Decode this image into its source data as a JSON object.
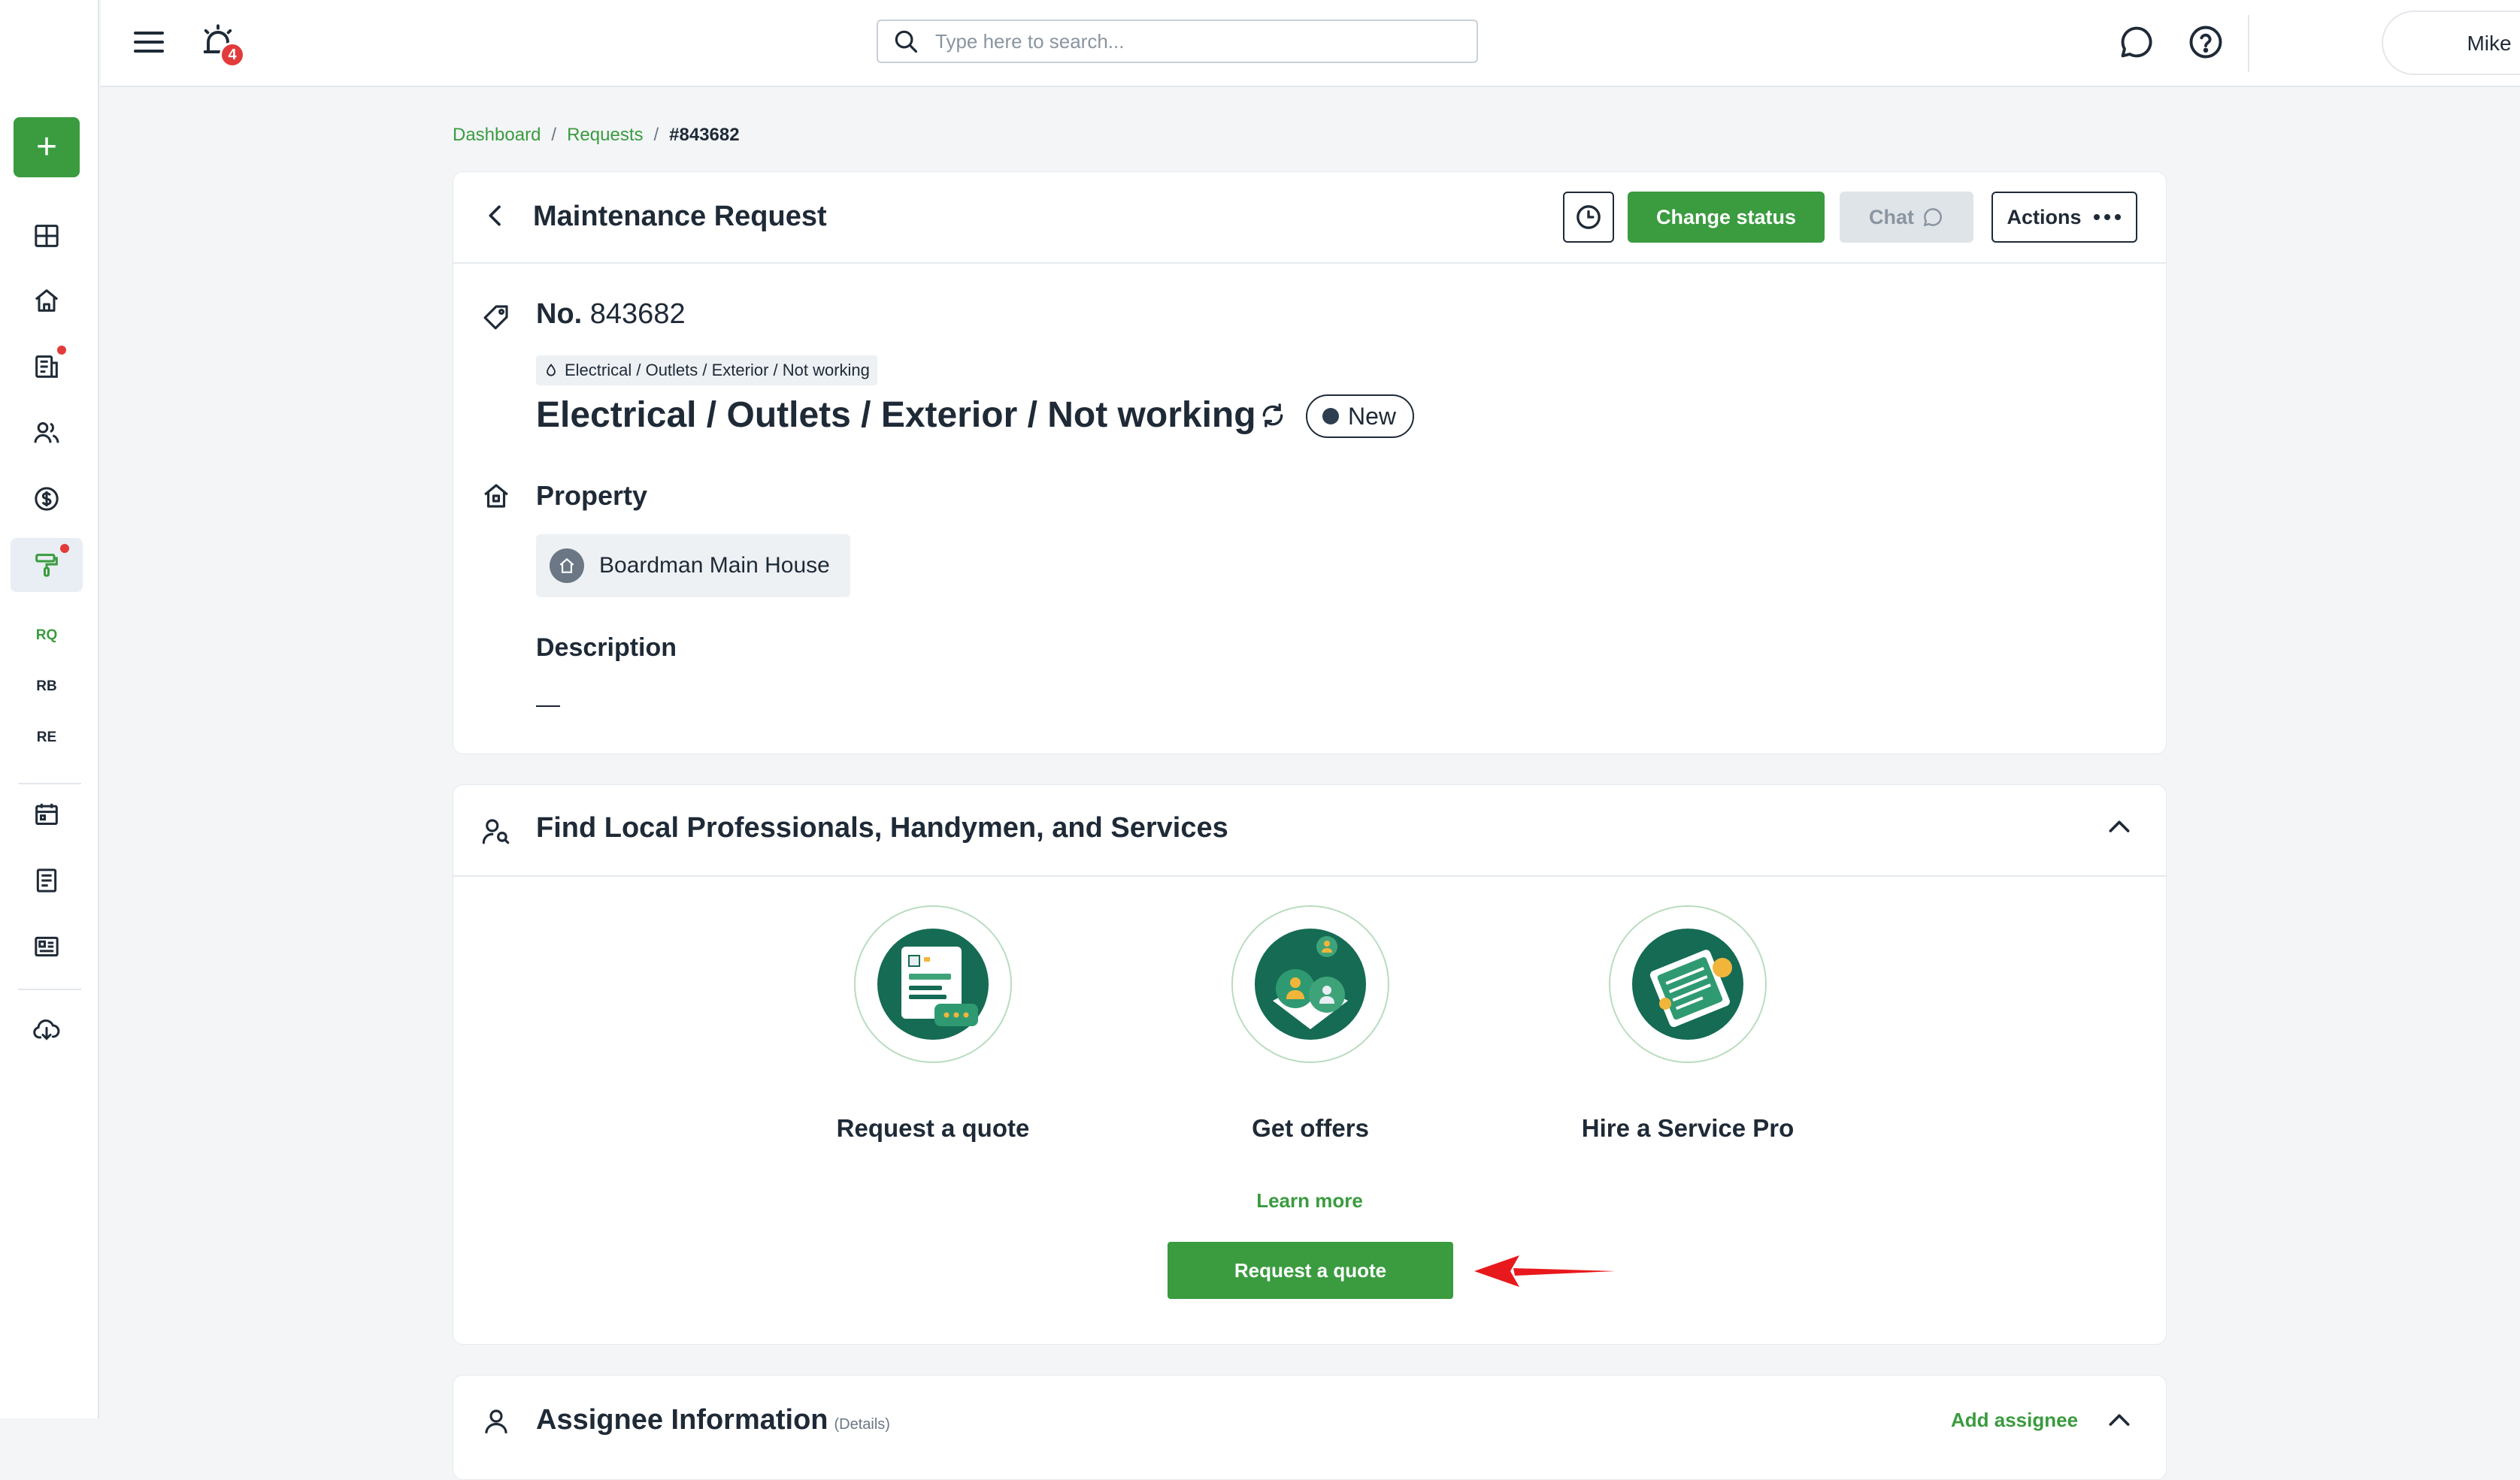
{
  "topbar": {
    "notification_count": "4",
    "search_placeholder": "Type here to search...",
    "user_name": "Mike"
  },
  "sidebar": {
    "add_label": "+",
    "sub_items": [
      "RQ",
      "RB",
      "RE"
    ]
  },
  "breadcrumb": {
    "items": [
      "Dashboard",
      "Requests"
    ],
    "separator": "/",
    "current": "#843682"
  },
  "request_card": {
    "title": "Maintenance Request",
    "change_status_label": "Change status",
    "chat_label": "Chat",
    "actions_label": "Actions",
    "number_prefix": "No.",
    "number": "843682",
    "category_chip": "Electrical / Outlets / Exterior / Not working",
    "issue_title": "Electrical / Outlets / Exterior / Not working",
    "status": "New",
    "property_label": "Property",
    "property_name": "Boardman Main House",
    "description_label": "Description",
    "description_value": "—"
  },
  "find_card": {
    "title": "Find Local Professionals, Handymen, and Services",
    "services": [
      {
        "label": "Request a quote",
        "icon": "quote-document-icon"
      },
      {
        "label": "Get offers",
        "icon": "offers-people-icon"
      },
      {
        "label": "Hire a Service Pro",
        "icon": "service-pro-card-icon"
      }
    ],
    "learn_more": "Learn more",
    "cta_label": "Request a quote"
  },
  "assignee_card": {
    "title": "Assignee Information",
    "details": "(Details)",
    "add_label": "Add assignee"
  },
  "colors": {
    "brand_green": "#3a9b3f",
    "alert_red": "#e23b3b",
    "text_dark": "#1f2a37",
    "background": "#f3f5f7"
  }
}
